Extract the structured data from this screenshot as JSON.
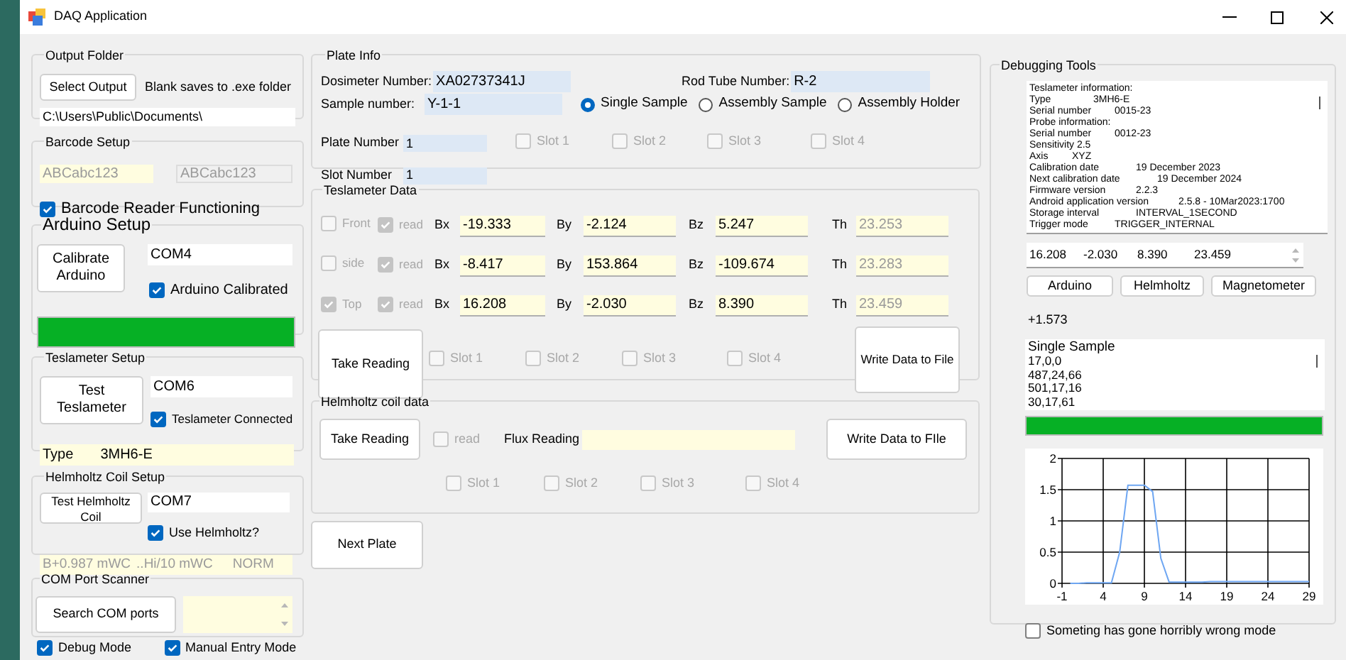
{
  "window": {
    "title": "DAQ Application"
  },
  "output_folder": {
    "title": "Output Folder",
    "button": "Select Output",
    "note": "Blank saves to .exe folder",
    "path": {
      "value": "C:\\Users\\Public\\Documents\\",
      "disabled": false
    }
  },
  "barcode_setup": {
    "title": "Barcode Setup",
    "fields": [
      {
        "value": "ABCabc123",
        "disabled": true
      },
      {
        "value": "ABCabc123",
        "disabled": true
      }
    ],
    "checkbox": {
      "label": "Barcode Reader Functioning",
      "checked": true,
      "disabled": false
    }
  },
  "arduino_setup": {
    "title": "Arduino Setup",
    "button": "Calibrate Arduino",
    "port": {
      "value": "COM4",
      "disabled": false
    },
    "checkbox": {
      "label": "Arduino Calibrated",
      "checked": true,
      "disabled": false
    },
    "progress": {
      "level": 1
    }
  },
  "teslameter_setup": {
    "title": "Teslameter Setup",
    "button": "Test Teslameter",
    "port": {
      "value": "COM6",
      "disabled": false
    },
    "checkbox": {
      "label": "Teslameter Connected",
      "checked": true,
      "disabled": false
    },
    "type_label": "Type",
    "type_value": "3MH6-E"
  },
  "helmholtz_setup": {
    "title": "Helmholtz Coil Setup",
    "button": "Test Helmholtz Coil",
    "port": {
      "value": "COM7",
      "disabled": false
    },
    "checkbox": {
      "label": "Use Helmholtz?",
      "checked": true,
      "disabled": false
    },
    "readout": [
      "B+0.987 mWC",
      "..Hi/10 mWC",
      "NORM"
    ]
  },
  "com_port_scanner": {
    "title": "COM Port Scanner",
    "button": "Search COM ports",
    "checkboxes": [
      {
        "label": "Debug Mode",
        "checked": true,
        "disabled": false
      },
      {
        "label": "Manual Entry Mode",
        "checked": true,
        "disabled": false
      }
    ]
  },
  "plate_info": {
    "title": "Plate Info",
    "dosimeter": {
      "label": "Dosimeter Number:",
      "value": "XA02737341J"
    },
    "rod_tube": {
      "label": "Rod Tube Number:",
      "value": "R-2"
    },
    "sample": {
      "label": "Sample number:",
      "value": "Y-1-1"
    },
    "sample_types": [
      {
        "label": "Single Sample",
        "selected": true
      },
      {
        "label": "Assembly Sample",
        "selected": false
      },
      {
        "label": "Assembly Holder",
        "selected": false
      }
    ],
    "plate_number": {
      "label": "Plate Number",
      "value": "1"
    },
    "slot_number": {
      "label": "Slot Number",
      "value": "1"
    },
    "slots": [
      {
        "label": "Slot 1",
        "checked": false,
        "disabled": true
      },
      {
        "label": "Slot 2",
        "checked": false,
        "disabled": true
      },
      {
        "label": "Slot 3",
        "checked": false,
        "disabled": true
      },
      {
        "label": "Slot 4",
        "checked": false,
        "disabled": true
      }
    ]
  },
  "teslameter_data": {
    "title": "Teslameter Data",
    "rows": [
      {
        "position": {
          "label": "Front",
          "checked": false,
          "disabled": true
        },
        "read": {
          "label": "read",
          "checked": true,
          "disabled": true
        },
        "values": [
          {
            "label": "Bx",
            "value": "-19.333",
            "disabled": false
          },
          {
            "label": "By",
            "value": "-2.124",
            "disabled": false
          },
          {
            "label": "Bz",
            "value": "5.247",
            "disabled": false
          },
          {
            "label": "Th",
            "value": "23.253",
            "disabled": true
          }
        ]
      },
      {
        "position": {
          "label": "side",
          "checked": false,
          "disabled": true
        },
        "read": {
          "label": "read",
          "checked": true,
          "disabled": true
        },
        "values": [
          {
            "label": "Bx",
            "value": "-8.417",
            "disabled": false
          },
          {
            "label": "By",
            "value": "153.864",
            "disabled": false
          },
          {
            "label": "Bz",
            "value": "-109.674",
            "disabled": false
          },
          {
            "label": "Th",
            "value": "23.283",
            "disabled": true
          }
        ]
      },
      {
        "position": {
          "label": "Top",
          "checked": true,
          "disabled": true
        },
        "read": {
          "label": "read",
          "checked": true,
          "disabled": true
        },
        "values": [
          {
            "label": "Bx",
            "value": "16.208",
            "disabled": false
          },
          {
            "label": "By",
            "value": "-2.030",
            "disabled": false
          },
          {
            "label": "Bz",
            "value": "8.390",
            "disabled": false
          },
          {
            "label": "Th",
            "value": "23.459",
            "disabled": true
          }
        ]
      }
    ],
    "take_reading": "Take Reading",
    "slots": [
      {
        "label": "Slot 1",
        "checked": false,
        "disabled": true
      },
      {
        "label": "Slot 2",
        "checked": false,
        "disabled": true
      },
      {
        "label": "Slot 3",
        "checked": false,
        "disabled": true
      },
      {
        "label": "Slot 4",
        "checked": false,
        "disabled": true
      }
    ],
    "write_button": "Write Data to File"
  },
  "helmholtz_data": {
    "title": "Helmholtz coil data",
    "take_reading": "Take Reading",
    "read": {
      "label": "read",
      "checked": false,
      "disabled": true
    },
    "flux_label": "Flux Reading",
    "write_button": "Write Data to FIle",
    "slots": [
      {
        "label": "Slot 1",
        "checked": false,
        "disabled": true
      },
      {
        "label": "Slot 2",
        "checked": false,
        "disabled": true
      },
      {
        "label": "Slot 3",
        "checked": false,
        "disabled": true
      },
      {
        "label": "Slot 4",
        "checked": false,
        "disabled": true
      }
    ]
  },
  "next_plate": "Next Plate",
  "debugging_tools": {
    "title": "Debugging Tools",
    "info_lines": [
      "Teslameter information:",
      "Type\t\t3MH6-E",
      "Serial number\t\t0015-23",
      "Probe information:",
      "Serial number\t\t0012-23",
      "Sensitivity 2.5",
      "Axis\t\tXYZ",
      "Calibration date\t\t19 December 2023",
      "Next calibration date\t\t19 December 2024",
      "Firmware version\t\t2.2.3",
      "Android application version\t\t2.5.8 - 10Mar2023:1700",
      "Storage interval\t\tINTERVAL_1SECOND",
      "Trigger mode\t\tTRIGGER_INTERNAL"
    ],
    "readings": [
      "16.208",
      "-2.030",
      "8.390",
      "23.459"
    ],
    "buttons": [
      "Arduino",
      "Helmholtz",
      "Magnetometer"
    ],
    "offset": "+1.573",
    "log_lines": [
      "Single Sample",
      "17,0,0",
      "487,24,66",
      "501,17,16",
      "30,17,61"
    ],
    "progress": {
      "level": 1
    },
    "chart_data": {
      "type": "line",
      "x": [
        0,
        1,
        2,
        3,
        4,
        5,
        6,
        7,
        8,
        9,
        10,
        11,
        12,
        13,
        14,
        15,
        16,
        17,
        18,
        19,
        20,
        21,
        22,
        23,
        24,
        25,
        26,
        27,
        28,
        29
      ],
      "series": [
        {
          "color": "#6ea6f2",
          "values": [
            0,
            0,
            0.01,
            0.01,
            0.01,
            0.01,
            0.5,
            1.57,
            1.57,
            1.57,
            1.47,
            0.4,
            0.02,
            0.02,
            0.02,
            0.02,
            0.02,
            0.03,
            0.03,
            0.03,
            0.03,
            0.03,
            0.03,
            0.03,
            0.03,
            0.03,
            0.03,
            0.03,
            0.03,
            0.03
          ]
        }
      ],
      "xlim": [
        -1,
        29
      ],
      "ylim": [
        0,
        2
      ],
      "grid": true,
      "xticks": [
        -1,
        4,
        9,
        14,
        19,
        24,
        29
      ],
      "yticks": [
        0,
        0.5,
        1,
        1.5,
        2
      ]
    },
    "checkbox": {
      "label": "Someting has gone horribly wrong mode",
      "checked": false,
      "disabled": false
    }
  }
}
